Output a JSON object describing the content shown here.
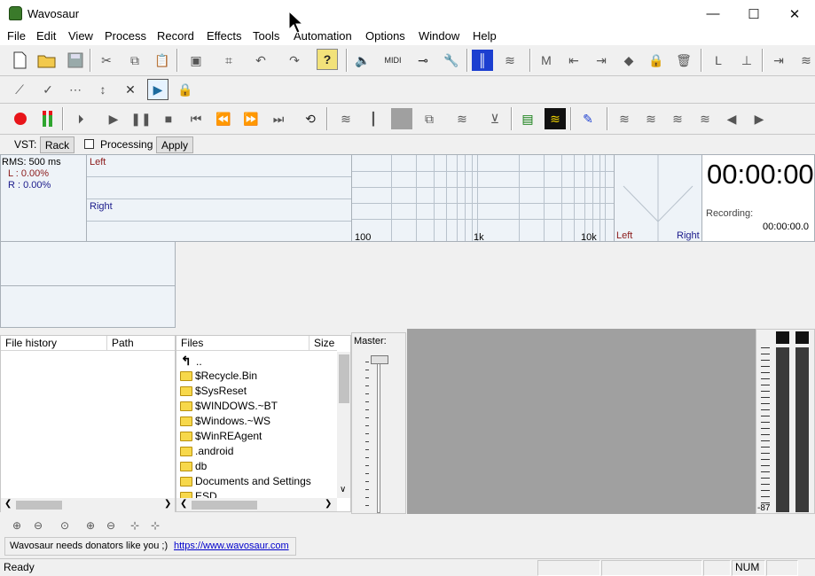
{
  "window": {
    "title": "Wavosaur",
    "minimize": "—",
    "maximize": "☐",
    "close": "✕"
  },
  "menu": [
    "File",
    "Edit",
    "View",
    "Process",
    "Record",
    "Effects",
    "Tools",
    "Automation",
    "Options",
    "Window",
    "Help"
  ],
  "vst": {
    "label": "VST:",
    "rack_button": "Rack",
    "processing_label": "Processing",
    "apply_button": "Apply"
  },
  "meter": {
    "rms": "RMS: 500 ms",
    "left_pct": "L : 0.00%",
    "right_pct": "R : 0.00%"
  },
  "waveform": {
    "left_channel": "Left",
    "right_channel": "Right"
  },
  "spectrum": {
    "tick_100": "100",
    "tick_1k": "1k",
    "tick_10k": "10k"
  },
  "stereo": {
    "left": "Left",
    "right": "Right"
  },
  "timer": {
    "time": "00:00:00",
    "recording_label": "Recording:",
    "recording_time": "00:00:00.0"
  },
  "file_history": {
    "col_history": "File history",
    "col_path": "Path"
  },
  "files": {
    "col_files": "Files",
    "col_size": "Size",
    "up": "..",
    "items": [
      "$Recycle.Bin",
      "$SysReset",
      "$WINDOWS.~BT",
      "$Windows.~WS",
      "$WinREAgent",
      ".android",
      "db",
      "Documents and Settings",
      "ESD"
    ]
  },
  "master": {
    "label": "Master:"
  },
  "vu": {
    "scale_bottom": "-87"
  },
  "donate": {
    "text": "Wavosaur needs donators like you ;)",
    "link": "https://www.wavosaur.com"
  },
  "status": {
    "ready": "Ready",
    "num": "NUM"
  },
  "colors": {
    "record_red": "#e8151a",
    "accent_blue": "#1c3fd0",
    "waveform_bg": "#eef3f8",
    "channel_label_red": "#8b1a1a"
  }
}
